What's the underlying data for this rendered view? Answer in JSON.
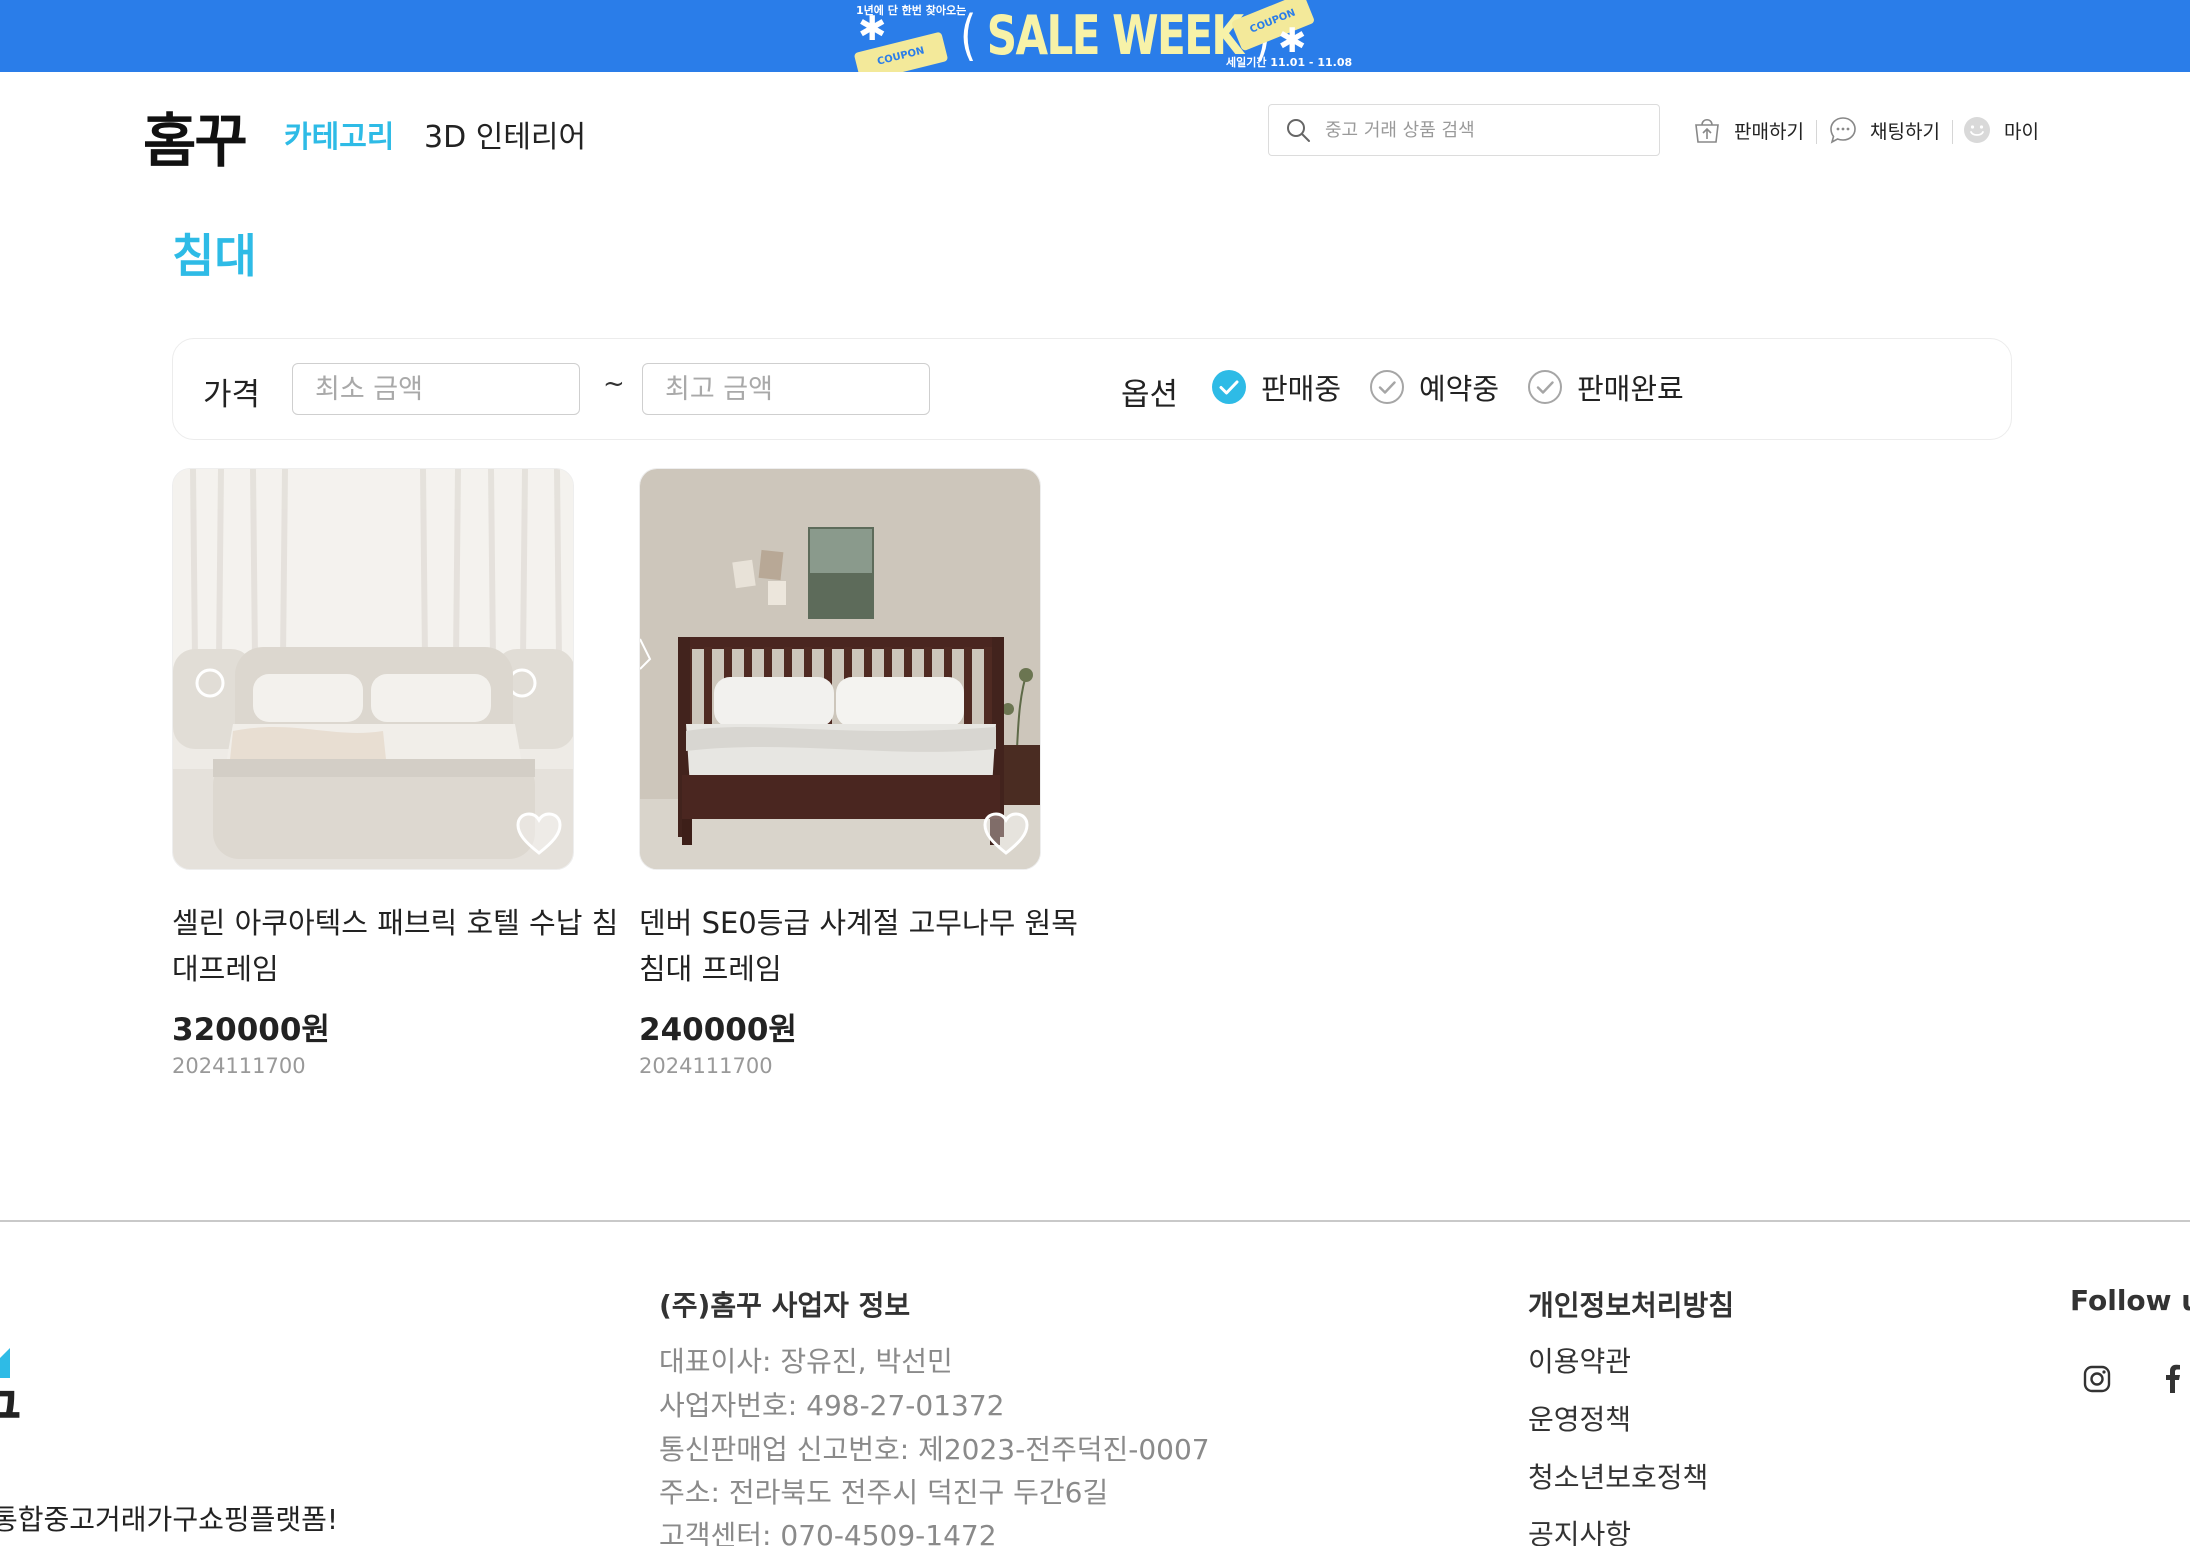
{
  "banner": {
    "small_text": "1년에 단 한번 찾아오는",
    "title": "SALE WEEK",
    "coupon": "COUPON",
    "period": "세일기간 11.01 - 11.08"
  },
  "header": {
    "logo": "홈꾸",
    "nav_category": "카테고리",
    "nav_3d": "3D 인테리어",
    "search_placeholder": "중고 거래 상품 검색",
    "sell_label": "판매하기",
    "chat_label": "채팅하기",
    "my_label": "마이"
  },
  "page": {
    "title": "침대"
  },
  "filter": {
    "price_label": "가격",
    "min_placeholder": "최소 금액",
    "max_placeholder": "최고 금액",
    "tilde": "~",
    "option_label": "옵션",
    "options": [
      {
        "label": "판매중",
        "checked": true
      },
      {
        "label": "예약중",
        "checked": false
      },
      {
        "label": "판매완료",
        "checked": false
      }
    ]
  },
  "products": [
    {
      "title": "셀린 아쿠아텍스 패브릭 호텔 수납 침대프레임",
      "price": "320000원",
      "date": "2024111700"
    },
    {
      "title": "덴버 SE0등급 사계절 고무나무 원목침대 프레임",
      "price": "240000원",
      "date": "2024111700"
    }
  ],
  "footer": {
    "slogan": "통합중고거래가구쇼핑플랫폼!",
    "company_title": "(주)홈꾸 사업자 정보",
    "company_info": [
      "대표이사: 장유진, 박선민",
      "사업자번호: 498-27-01372",
      "통신판매업 신고번호: 제2023-전주덕진-0007",
      "주소: 전라북도 전주시 덕진구 두간6길",
      "고객센터: 070-4509-1472"
    ],
    "policy_title": "개인정보처리방침",
    "links": [
      "이용약관",
      "운영정책",
      "청소년보호정책",
      "공지사항"
    ],
    "follow_title": "Follow us"
  },
  "colors": {
    "accent": "#2ebbe6",
    "banner": "#2a7de9"
  }
}
